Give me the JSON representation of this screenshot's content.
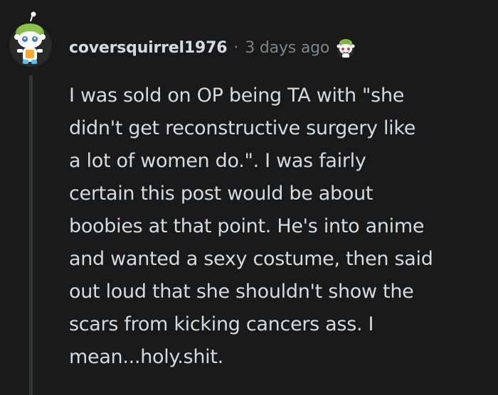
{
  "comment": {
    "username": "coversquirrel1976",
    "separator": "·",
    "timestamp": "3 days ago",
    "avatar_icon": "snoo-avatar-icon",
    "award_icon": "snoo-award-icon",
    "body_lines": [
      "I was sold on OP being TA with \"she",
      "didn't get reconstructive surgery like",
      "a lot of women do.\". I was fairly",
      "certain this post would be about",
      "boobies at that point. He's into anime",
      "and wanted a sexy costume, then said",
      "out loud that she shouldn't show the",
      "scars from kicking cancers ass. I",
      "mean...holy.shit."
    ]
  },
  "colors": {
    "background": "#1a1a1b",
    "text": "#d7dadc",
    "meta": "#818384",
    "thread_line": "#343536",
    "avatar_green": "#8bc34a"
  }
}
